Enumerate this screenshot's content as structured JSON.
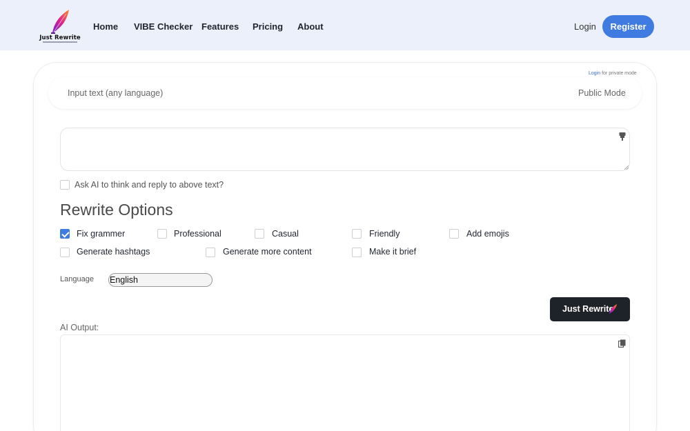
{
  "brand": {
    "name": "Just Rewrite",
    "colors": {
      "accent": "#3f7be0",
      "nav_bg": "#ebf0fa",
      "dark_button": "#1e2229"
    }
  },
  "nav": {
    "links": [
      "Home",
      "VIBE Checker",
      "Features",
      "Pricing",
      "About"
    ],
    "login": "Login",
    "register": "Register"
  },
  "mode": {
    "private_link": "Login",
    "private_suffix": " for private mode",
    "input_label": "Input text (any language)",
    "public_mode": "Public Mode"
  },
  "input": {
    "value": ""
  },
  "ask_ai": {
    "label": "Ask AI to think and reply to above text?",
    "checked": false
  },
  "options": {
    "title": "Rewrite Options",
    "items": [
      {
        "label": "Fix grammer",
        "checked": true
      },
      {
        "label": "Professional",
        "checked": false
      },
      {
        "label": "Casual",
        "checked": false
      },
      {
        "label": "Friendly",
        "checked": false
      },
      {
        "label": "Add emojis",
        "checked": false
      },
      {
        "label": "Generate hashtags",
        "checked": false
      },
      {
        "label": "Generate more content",
        "checked": false
      },
      {
        "label": "Make it brief",
        "checked": false
      }
    ]
  },
  "language": {
    "label": "Language",
    "selected": "English"
  },
  "action": {
    "label": "Just Rewrite",
    "icon": "feather-icon"
  },
  "output": {
    "label": "AI Output:",
    "value": ""
  },
  "icons": {
    "textarea": "pin-icon",
    "output": "copy-icon"
  }
}
